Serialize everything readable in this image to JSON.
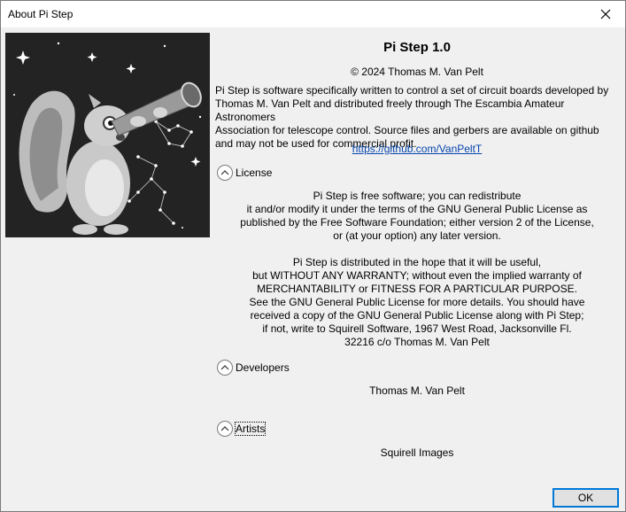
{
  "window": {
    "title": "About Pi Step"
  },
  "about": {
    "app_title": "Pi Step 1.0",
    "copyright": "© 2024 Thomas M. Van Pelt",
    "description": [
      "Pi Step is software specifically written to control a set of circuit boards developed by",
      "Thomas M. Van Pelt and distributed freely through The Escambia Amateur Astronomers",
      "Association for telescope control. Source files and gerbers are available on github",
      "and may not be used for commercial profit."
    ],
    "link": "https://github.com/VanPeltT"
  },
  "license": {
    "label": "License",
    "paragraph1": [
      "Pi Step is free software; you can redistribute",
      "it and/or modify it under the terms of the GNU General Public License as",
      "published by the Free Software Foundation; either version 2 of the License,",
      "or (at your option) any later version."
    ],
    "paragraph2": [
      "Pi Step is distributed in the hope that it will be useful,",
      "but WITHOUT ANY WARRANTY; without even the implied warranty of",
      "MERCHANTABILITY or FITNESS FOR A PARTICULAR PURPOSE.",
      "See the GNU General Public License for more details. You should have",
      "received a copy of the GNU General Public License along with Pi Step;",
      "if not, write to Squirell Software, 1967 West Road, Jacksonville Fl.",
      "32216 c/o Thomas M. Van Pelt"
    ]
  },
  "developers": {
    "label": "Developers",
    "name": "Thomas M. Van Pelt"
  },
  "artists": {
    "label": "Artists",
    "name": "Squirell Images"
  },
  "buttons": {
    "ok": "OK"
  },
  "icons": {
    "close": "close-icon",
    "chevron": "chevron-up-icon"
  }
}
